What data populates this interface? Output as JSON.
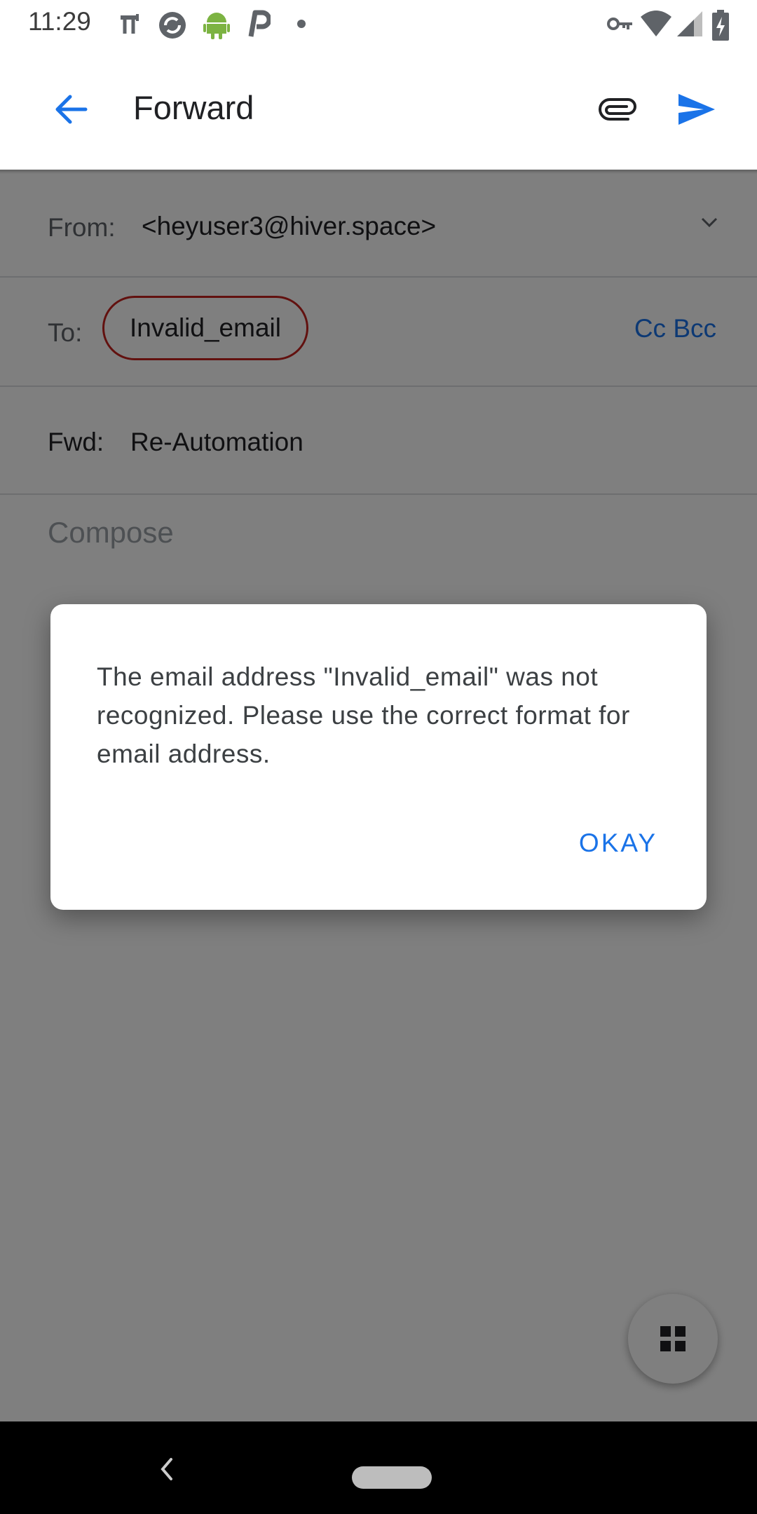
{
  "status_bar": {
    "time": "11:29",
    "left_icons": [
      "hdmi-icon",
      "sync-icon",
      "android-icon",
      "p-app-icon",
      "dot-icon"
    ],
    "right_icons": [
      "vpn-key-icon",
      "wifi-icon",
      "cell-signal-icon",
      "battery-charging-icon"
    ]
  },
  "app_bar": {
    "title": "Forward",
    "back_icon": "arrow-back-icon",
    "attach_icon": "paperclip-icon",
    "send_icon": "send-icon",
    "accent": "#1a73e8"
  },
  "form": {
    "from_label": "From:",
    "from_value": "<heyuser3@hiver.space>",
    "to_label": "To:",
    "to_chip": "Invalid_email",
    "cc_bcc": "Cc Bcc",
    "subject_label": "Fwd:",
    "subject_value": "Re-Automation",
    "compose_placeholder": "Compose"
  },
  "dialog": {
    "message": "The email address \"Invalid_email\" was not recognized. Please use the correct format for email address.",
    "button": "OKAY"
  },
  "fab": {
    "icon": "grid-icon"
  },
  "colors": {
    "error_chip_border": "#c5221f",
    "scrim": "rgba(0,0,0,0.5)"
  }
}
